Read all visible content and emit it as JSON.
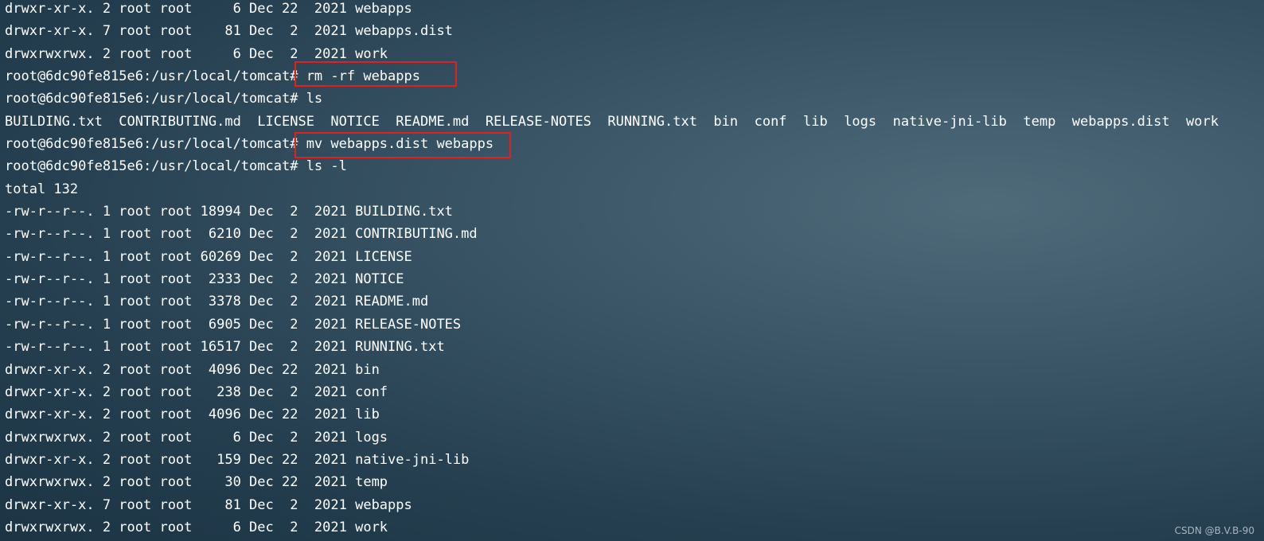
{
  "terminal": {
    "lines": [
      "drwxr-xr-x. 2 root root     6 Dec 22  2021 webapps",
      "drwxr-xr-x. 7 root root    81 Dec  2  2021 webapps.dist",
      "drwxrwxrwx. 2 root root     6 Dec  2  2021 work",
      "root@6dc90fe815e6:/usr/local/tomcat# rm -rf webapps",
      "root@6dc90fe815e6:/usr/local/tomcat# ls",
      "BUILDING.txt  CONTRIBUTING.md  LICENSE  NOTICE  README.md  RELEASE-NOTES  RUNNING.txt  bin  conf  lib  logs  native-jni-lib  temp  webapps.dist  work",
      "root@6dc90fe815e6:/usr/local/tomcat# mv webapps.dist webapps",
      "root@6dc90fe815e6:/usr/local/tomcat# ls -l",
      "total 132",
      "-rw-r--r--. 1 root root 18994 Dec  2  2021 BUILDING.txt",
      "-rw-r--r--. 1 root root  6210 Dec  2  2021 CONTRIBUTING.md",
      "-rw-r--r--. 1 root root 60269 Dec  2  2021 LICENSE",
      "-rw-r--r--. 1 root root  2333 Dec  2  2021 NOTICE",
      "-rw-r--r--. 1 root root  3378 Dec  2  2021 README.md",
      "-rw-r--r--. 1 root root  6905 Dec  2  2021 RELEASE-NOTES",
      "-rw-r--r--. 1 root root 16517 Dec  2  2021 RUNNING.txt",
      "drwxr-xr-x. 2 root root  4096 Dec 22  2021 bin",
      "drwxr-xr-x. 2 root root   238 Dec  2  2021 conf",
      "drwxr-xr-x. 2 root root  4096 Dec 22  2021 lib",
      "drwxrwxrwx. 2 root root     6 Dec  2  2021 logs",
      "drwxr-xr-x. 2 root root   159 Dec 22  2021 native-jni-lib",
      "drwxrwxrwx. 2 root root    30 Dec 22  2021 temp",
      "drwxr-xr-x. 7 root root    81 Dec  2  2021 webapps",
      "drwxrwxrwx. 2 root root     6 Dec  2  2021 work"
    ],
    "text_color": "#ffffff",
    "highlight_color": "#e41f1f"
  },
  "watermark": {
    "text": "CSDN @B.V.B-90"
  }
}
